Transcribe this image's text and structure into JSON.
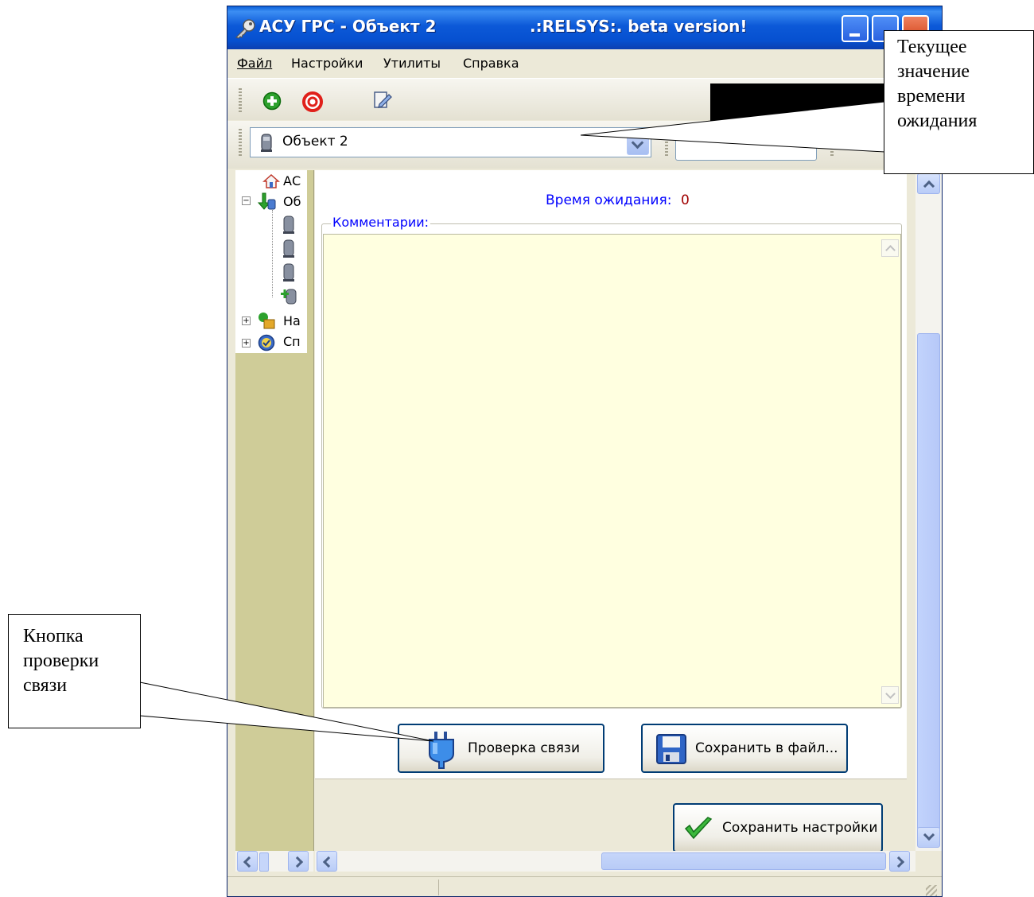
{
  "window": {
    "title": "АСУ ГРС - Объект 2",
    "title_right": ".:RELSYS:. beta version!"
  },
  "menu": [
    {
      "label": "Файл"
    },
    {
      "label": "Настройки"
    },
    {
      "label": "Утилиты"
    },
    {
      "label": "Справка"
    }
  ],
  "toolbar": {
    "object_select_value": "Объект 2"
  },
  "tree": {
    "items": [
      "АС",
      "Об",
      "На",
      "Сп"
    ]
  },
  "content": {
    "wait_label": "Время ожидания:",
    "wait_value": "0",
    "comments_legend": "Комментарии:",
    "check_connection_label": "Проверка связи",
    "save_to_file_label": "Сохранить в файл...",
    "save_settings_label": "Сохранить настройки"
  },
  "callouts": {
    "wait_time_callout": "Текущее значение времени ожидания",
    "check_button_callout": "Кнопка проверки связи"
  },
  "colors": {
    "titlebar": "#0c59d8",
    "comment_area": "#ffffe0",
    "wait_label": "#0000ff",
    "wait_value": "#a00000",
    "tree_panel": "#cfcc98"
  }
}
